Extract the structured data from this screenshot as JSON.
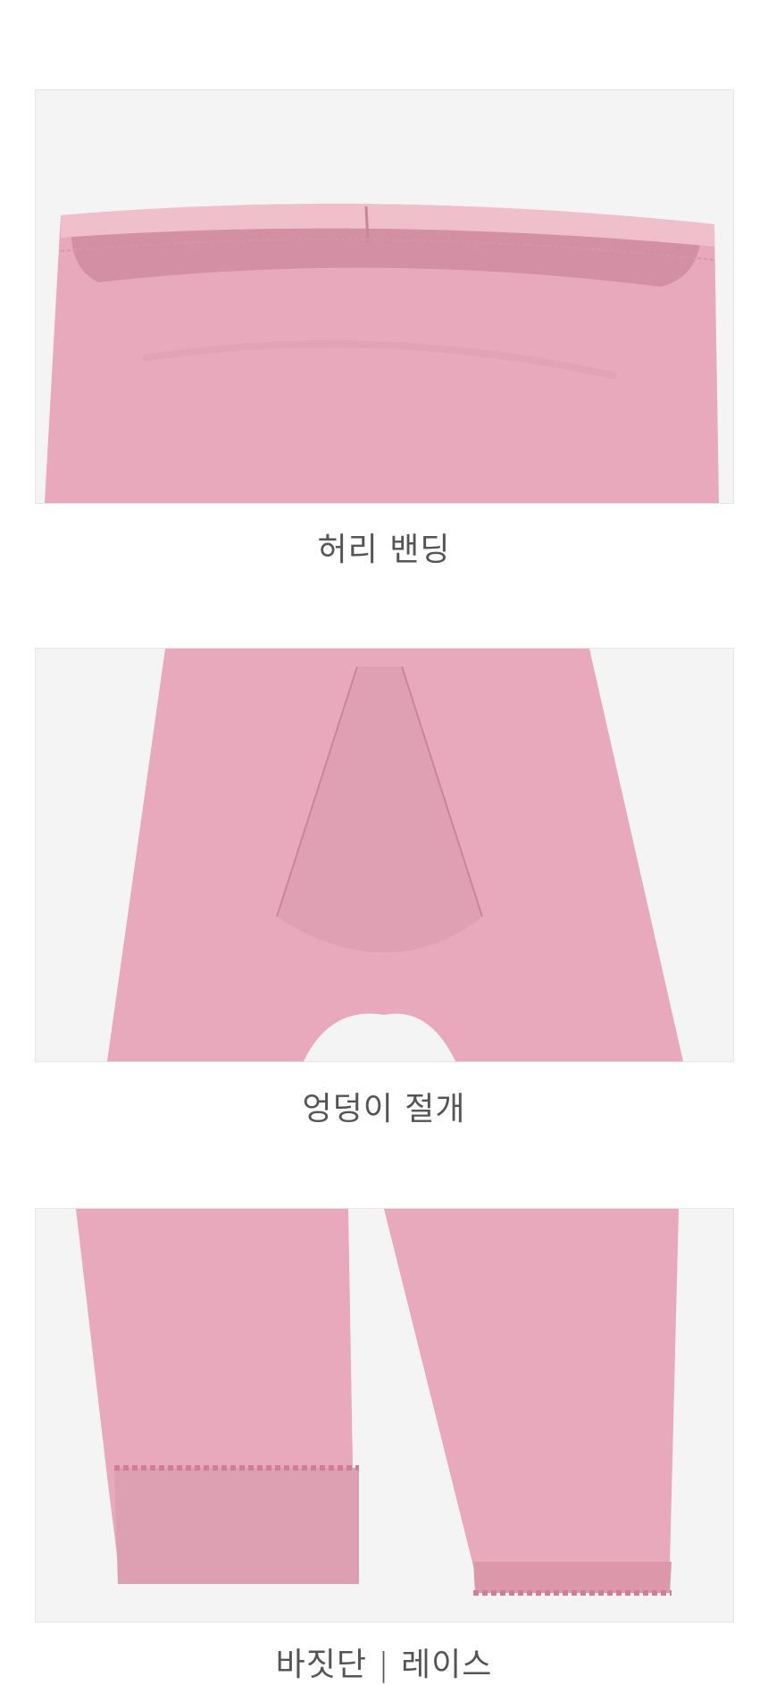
{
  "sections": [
    {
      "caption": "허리 밴딩"
    },
    {
      "caption": "엉덩이 절개"
    },
    {
      "caption": "바짓단 | 레이스"
    }
  ],
  "colors": {
    "fabric": "#e7a9bb",
    "fabric_shadow": "#d38fa3",
    "fabric_light": "#efbfcc",
    "backdrop": "#f4f4f5",
    "caption": "#555555"
  }
}
